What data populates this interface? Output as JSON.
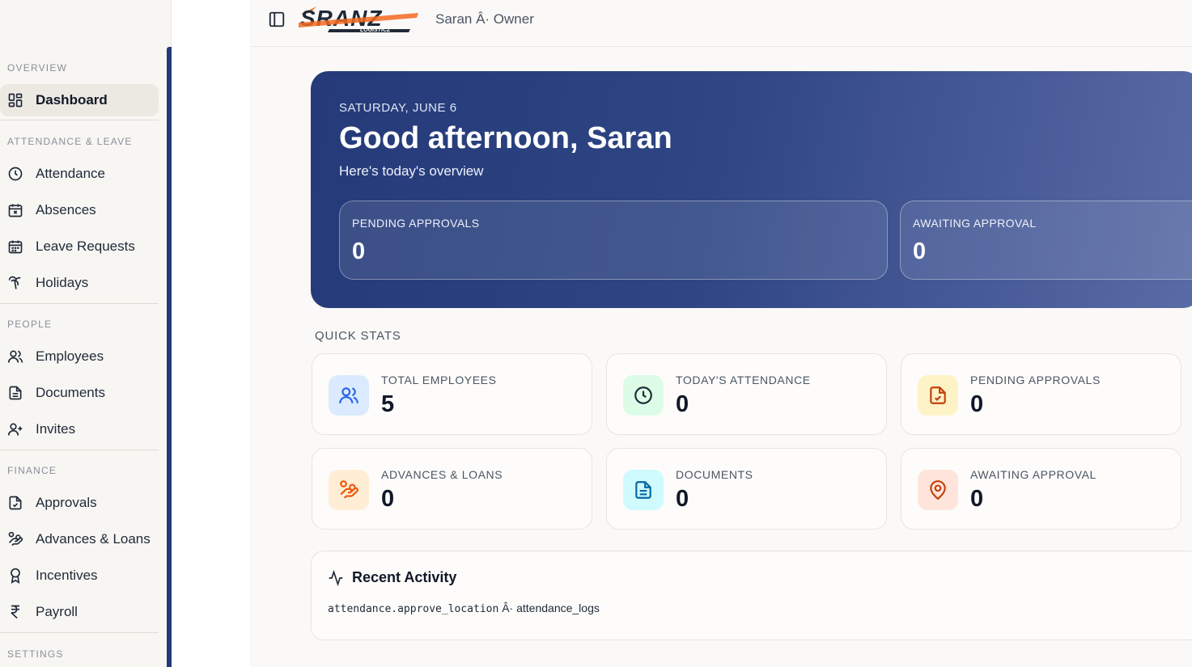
{
  "header": {
    "user_label": "Saran Â· Owner",
    "brand_text": "SRANZ",
    "brand_sub": "LOGISTICZ"
  },
  "sidebar": {
    "sections": {
      "overview": "OVERVIEW",
      "attendance": "ATTENDANCE & LEAVE",
      "people": "PEOPLE",
      "finance": "FINANCE",
      "settings": "SETTINGS"
    },
    "items": {
      "dashboard": "Dashboard",
      "attendance": "Attendance",
      "absences": "Absences",
      "leave_requests": "Leave Requests",
      "holidays": "Holidays",
      "employees": "Employees",
      "documents": "Documents",
      "invites": "Invites",
      "approvals": "Approvals",
      "advances_loans": "Advances & Loans",
      "incentives": "Incentives",
      "payroll": "Payroll"
    }
  },
  "hero": {
    "date": "SATURDAY, JUNE 6",
    "greeting": "Good afternoon, Saran",
    "subtitle": "Here's today's overview",
    "cards": [
      {
        "label": "PENDING APPROVALS",
        "value": "0"
      },
      {
        "label": "AWAITING APPROVAL",
        "value": "0"
      }
    ]
  },
  "quick_stats": {
    "label": "QUICK STATS",
    "cards": [
      {
        "label": "TOTAL EMPLOYEES",
        "value": "5",
        "icon": "users-icon"
      },
      {
        "label": "TODAY'S ATTENDANCE",
        "value": "0",
        "icon": "clock-icon"
      },
      {
        "label": "PENDING APPROVALS",
        "value": "0",
        "icon": "file-check-icon"
      },
      {
        "label": "ADVANCES & LOANS",
        "value": "0",
        "icon": "hand-coins-icon"
      },
      {
        "label": "DOCUMENTS",
        "value": "0",
        "icon": "file-text-icon"
      },
      {
        "label": "AWAITING APPROVAL",
        "value": "0",
        "icon": "map-pin-icon"
      }
    ]
  },
  "activity": {
    "title": "Recent Activity",
    "rows": [
      {
        "action": "attendance.approve_location",
        "separator": "Â·",
        "target": "attendance_logs"
      }
    ]
  },
  "colors": {
    "accent": "#25397a",
    "hero_start": "#253a78",
    "hero_end": "#5a6ca6",
    "brand_orange": "#f26a21"
  }
}
